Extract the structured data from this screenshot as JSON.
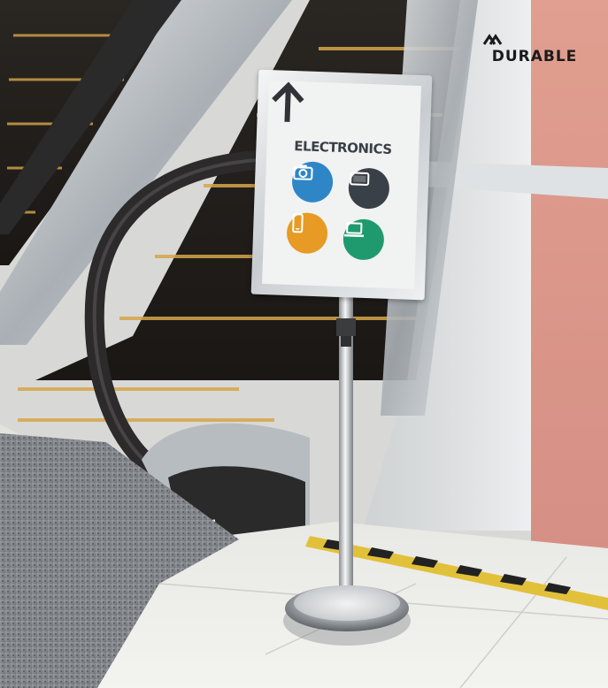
{
  "brand": {
    "name": "DURABLE",
    "logo_icon": "double-chevron-logo-icon"
  },
  "sign": {
    "title": "ELECTRONICS",
    "arrow_icon": "arrow-up-icon",
    "icons": [
      {
        "name": "camera-icon",
        "color": "#2f86c7"
      },
      {
        "name": "tablet-icon",
        "color": "#3a4048"
      },
      {
        "name": "smartphone-icon",
        "color": "#e79a24"
      },
      {
        "name": "laptop-icon",
        "color": "#1f9a6f"
      }
    ]
  },
  "scene": {
    "subjects": [
      "escalator",
      "sign-stand"
    ],
    "colors": {
      "escalator_metal": "#b7bcc0",
      "handrail": "#2c2a2b",
      "step_light": "#d6a64a",
      "floor": "#e9e9e6",
      "floor_plate": "#8d9196",
      "warning_stripe": "#e2c13a"
    }
  }
}
